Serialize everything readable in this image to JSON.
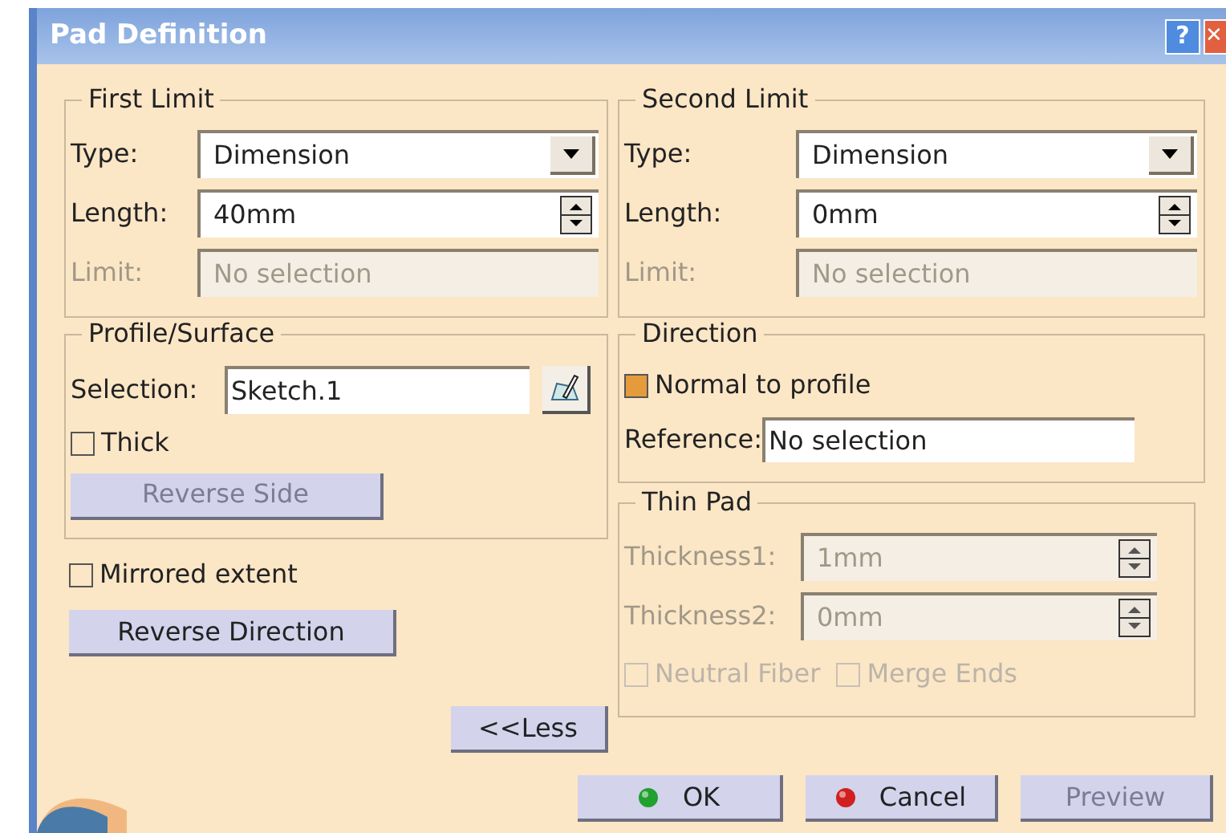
{
  "window": {
    "title": "Pad Definition",
    "help": "?",
    "close": "✕"
  },
  "limits": [
    {
      "title": "First Limit",
      "fields": [
        {
          "kind": "dropdown",
          "label": "Type:",
          "value": "Dimension",
          "disabled": false
        },
        {
          "kind": "spinner",
          "label": "Length:",
          "value": "40mm",
          "disabled": false
        },
        {
          "kind": "text",
          "label": "Limit:",
          "value": "No selection",
          "disabled": true
        }
      ]
    },
    {
      "title": "Second Limit",
      "fields": [
        {
          "kind": "dropdown",
          "label": "Type:",
          "value": "Dimension",
          "disabled": false
        },
        {
          "kind": "spinner",
          "label": "Length:",
          "value": "0mm",
          "disabled": false
        },
        {
          "kind": "text",
          "label": "Limit:",
          "value": "No selection",
          "disabled": true
        }
      ]
    }
  ],
  "profile": {
    "title": "Profile/Surface",
    "selection_label": "Selection:",
    "selection_value": "Sketch.1",
    "thick": {
      "label": "Thick",
      "checked": false
    },
    "reverse_side": {
      "label": "Reverse Side",
      "disabled": true
    }
  },
  "mirrored": {
    "label": "Mirrored extent",
    "checked": false
  },
  "reverse_direction": {
    "label": "Reverse Direction",
    "disabled": false
  },
  "less_button": {
    "label": "<<Less",
    "disabled": false
  },
  "direction": {
    "title": "Direction",
    "normal": {
      "label": "Normal to profile",
      "checked": true
    },
    "reference_label": "Reference:",
    "reference_value": "No selection"
  },
  "thin_pad": {
    "title": "Thin Pad",
    "fields": [
      {
        "kind": "spinner",
        "label": "Thickness1:",
        "value": "1mm",
        "disabled": true
      },
      {
        "kind": "spinner",
        "label": "Thickness2:",
        "value": "0mm",
        "disabled": true
      }
    ],
    "checks": [
      {
        "label": "Neutral Fiber",
        "checked": false,
        "disabled": true
      },
      {
        "label": "Merge Ends",
        "checked": false,
        "disabled": true
      }
    ]
  },
  "buttons": [
    {
      "kind": "ok",
      "label": "OK",
      "disabled": false
    },
    {
      "kind": "cancel",
      "label": "Cancel",
      "disabled": false
    },
    {
      "kind": "plain",
      "label": "Preview",
      "disabled": true
    }
  ]
}
